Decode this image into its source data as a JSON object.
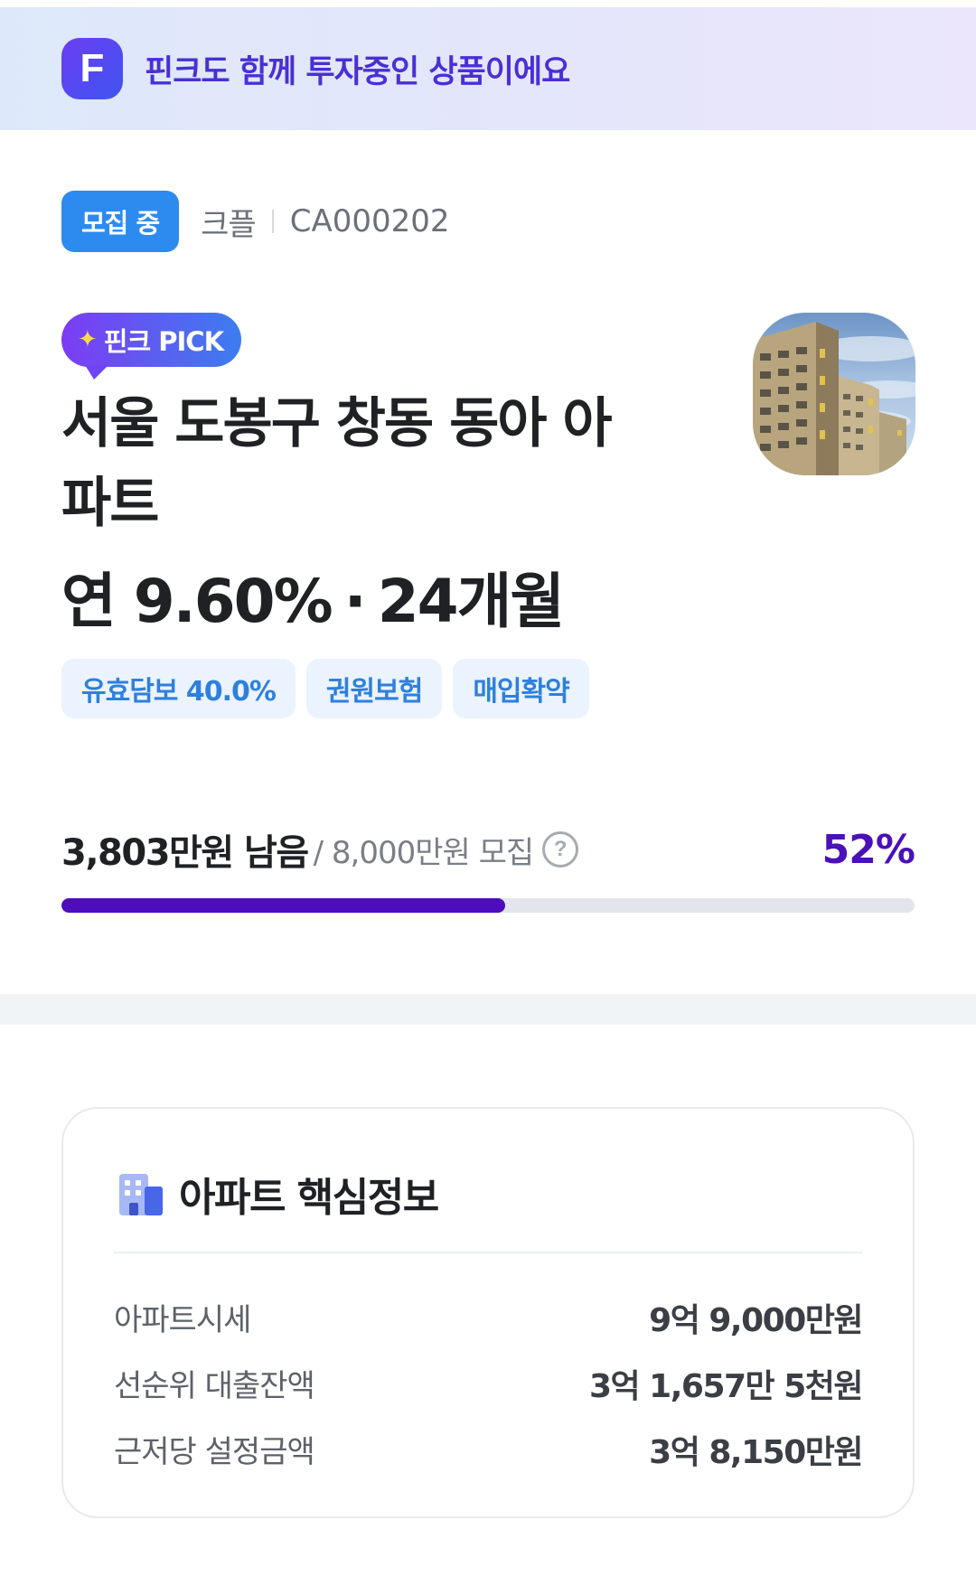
{
  "banner": {
    "logo_letter": "F",
    "text": "핀크도 함께 투자중인 상품이에요"
  },
  "status": {
    "badge": "모집 중",
    "company": "크플",
    "code": "CA000202"
  },
  "pick_tag": {
    "label": "핀크 PICK"
  },
  "product": {
    "title": "서울 도봉구 창동 동아 아파트",
    "rate": "연 9.60%",
    "period": "24개월",
    "separator": "·"
  },
  "chips": [
    {
      "label": "유효담보 40.0%"
    },
    {
      "label": "권원보험"
    },
    {
      "label": "매입확약"
    }
  ],
  "funding": {
    "remaining": "3,803만원 남음",
    "goal": "/ 8,000만원 모집",
    "percent_text": "52%",
    "progress": 0.52
  },
  "info_card": {
    "title": "아파트 핵심정보",
    "rows": [
      {
        "label": "아파트시세",
        "value": "9억 9,000만원"
      },
      {
        "label": "선순위 대출잔액",
        "value": "3억 1,657만 5천원"
      },
      {
        "label": "근저당 설정금액",
        "value": "3억 8,150만원"
      }
    ]
  },
  "colors": {
    "accent_purple": "#4d0dbd",
    "badge_blue": "#2d8bf0",
    "chip_text": "#2f7fdd"
  }
}
